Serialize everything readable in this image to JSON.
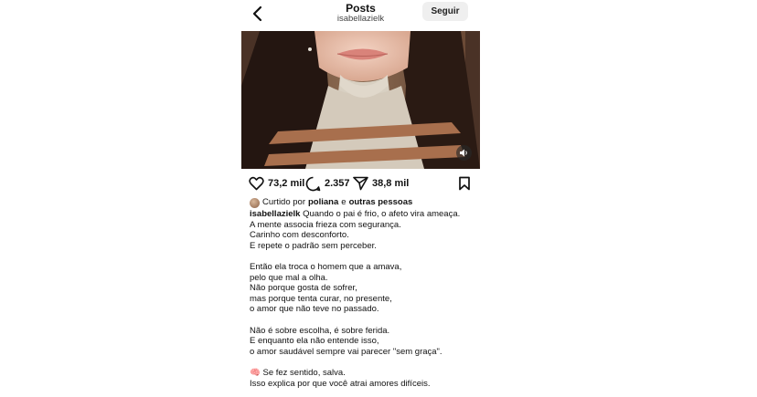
{
  "header": {
    "title": "Posts",
    "username": "isabellazielk",
    "follow_label": "Seguir"
  },
  "actions": {
    "likes": "73,2 mil",
    "comments": "2.357",
    "shares": "38,8 mil"
  },
  "liked_by": {
    "prefix": "Curtido por",
    "user": "poliana",
    "connector": "e",
    "others": "outras pessoas"
  },
  "caption": {
    "author": "isabellazielk",
    "first_line": "Quando o pai é frio, o afeto vira ameaça.",
    "lines": [
      "A mente associa frieza com segurança.",
      "Carinho com desconforto.",
      "E repete o padrão sem perceber.",
      "",
      "Então ela troca o homem que a amava,",
      "pelo que mal a olha.",
      "Não porque gosta de sofrer,",
      "mas porque tenta curar, no presente,",
      "o amor que não teve no passado.",
      "",
      "Não é sobre escolha, é sobre ferida.",
      "E enquanto ela não entende isso,",
      "o amor saudável sempre vai parecer \"sem graça\".",
      ""
    ],
    "closing_emoji": "🧠",
    "closing_first": "Se fez sentido, salva.",
    "closing_last": "Isso explica por que você atrai amores difíceis."
  },
  "icons": {
    "back": "chevron-left-icon",
    "like": "heart-icon",
    "comment": "comment-icon",
    "share": "send-icon",
    "save": "bookmark-icon",
    "sound": "speaker-icon"
  }
}
